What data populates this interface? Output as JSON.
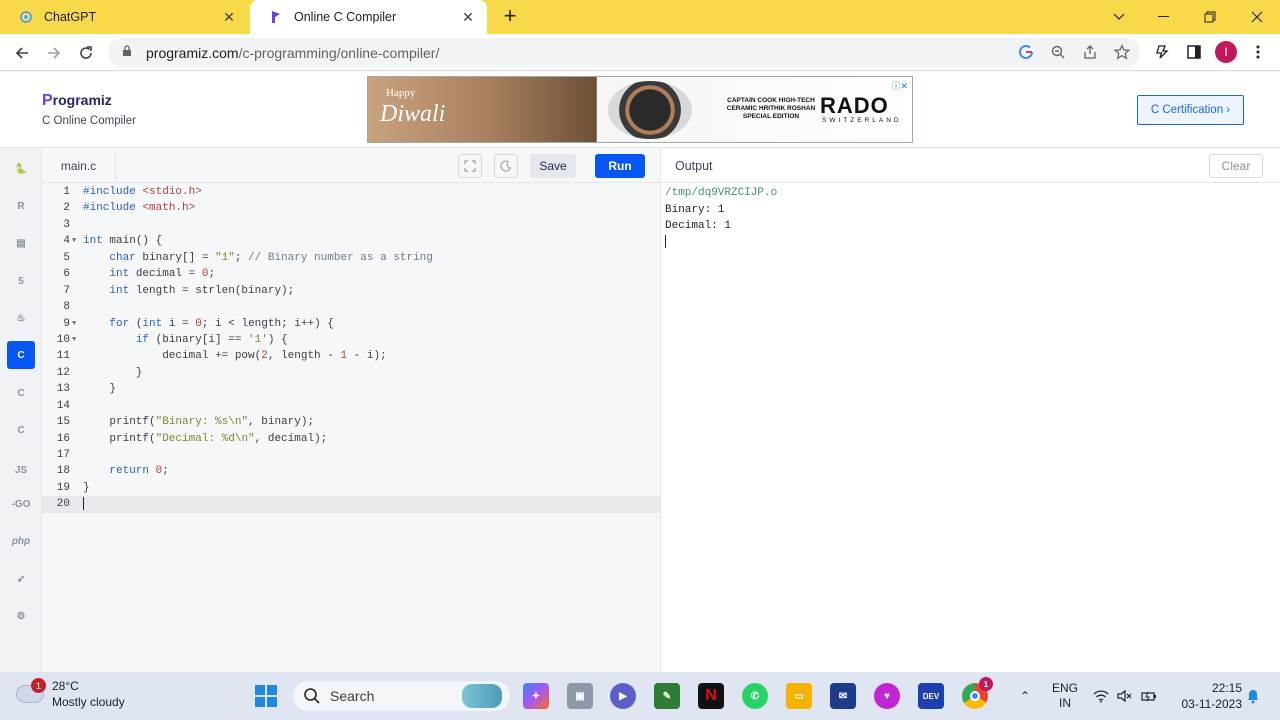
{
  "browser": {
    "tabs": [
      {
        "title": "ChatGPT",
        "icon": "chatgpt-icon",
        "active": false
      },
      {
        "title": "Online C Compiler",
        "icon": "programiz-icon",
        "active": true
      }
    ],
    "url_domain": "programiz.com",
    "url_path": "/c-programming/online-compiler/",
    "profile_initial": "I"
  },
  "site": {
    "logo_text": "rogramiz",
    "logo_letter": "P",
    "subtitle": "C Online Compiler",
    "certification_label": "C Certification ›",
    "ad": {
      "happy": "Happy",
      "diwali": "Diwali",
      "copy": "CAPTAIN COOK HIGH-TECH CERAMIC HRITHIK ROSHAN SPECIAL EDITION",
      "brand": "RADO",
      "brand_sub": "SWITZERLAND"
    }
  },
  "rail": {
    "items": [
      {
        "name": "python",
        "glyph": "🐍"
      },
      {
        "name": "r",
        "glyph": "R"
      },
      {
        "name": "sql",
        "glyph": "▤"
      },
      {
        "name": "html",
        "glyph": "5"
      },
      {
        "name": "java",
        "glyph": "♨"
      },
      {
        "name": "c",
        "glyph": "C",
        "active": true
      },
      {
        "name": "cpp",
        "glyph": "C"
      },
      {
        "name": "csharp",
        "glyph": "C"
      },
      {
        "name": "javascript",
        "glyph": "JS"
      },
      {
        "name": "go",
        "glyph": "-GO"
      },
      {
        "name": "php",
        "glyph": "php"
      },
      {
        "name": "swift",
        "glyph": "➶"
      },
      {
        "name": "rust",
        "glyph": "⚙"
      }
    ]
  },
  "editor": {
    "file_tab": "main.c",
    "save_label": "Save",
    "run_label": "Run"
  },
  "output": {
    "title": "Output",
    "clear_label": "Clear",
    "lines": [
      "/tmp/dq9VRZCIJP.o",
      "Binary: 1",
      "Decimal: 1"
    ]
  },
  "taskbar": {
    "weather_temp": "28°C",
    "weather_desc": "Mostly cloudy",
    "weather_badge": "1",
    "search_placeholder": "Search",
    "lang_top": "ENG",
    "lang_bottom": "IN",
    "time": "22:15",
    "date": "03-11-2023",
    "chrome_badge": "1"
  },
  "colors": {
    "tabstrip": "#f7d94a",
    "accent": "#0556f3",
    "brand_purple": "#6b3de6"
  }
}
